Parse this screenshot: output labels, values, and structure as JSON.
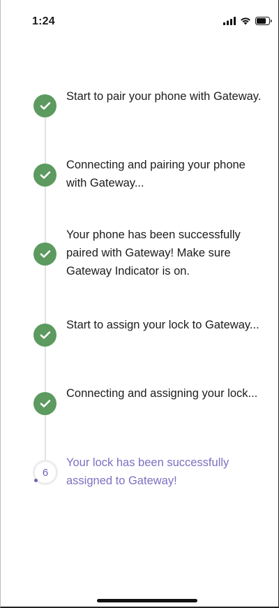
{
  "status_bar": {
    "time": "1:24",
    "icons": [
      "cellular-signal-icon",
      "wifi-icon",
      "battery-icon"
    ]
  },
  "steps": [
    {
      "status": "done",
      "text": "Start to pair your phone with Gateway."
    },
    {
      "status": "done",
      "text": "Connecting and pairing your phone with Gateway..."
    },
    {
      "status": "done",
      "text": "Your phone has been successfully paired with Gateway! Make sure Gateway Indicator is on."
    },
    {
      "status": "done",
      "text": "Start to assign your lock to Gateway..."
    },
    {
      "status": "done",
      "text": "Connecting and assigning your lock..."
    },
    {
      "status": "in-progress",
      "number": "6",
      "text": "Your lock has been successfully assigned to Gateway!"
    }
  ],
  "colors": {
    "done": "#5c9a5f",
    "active_text": "#7d6fc2",
    "timeline": "#e3e3e6"
  }
}
